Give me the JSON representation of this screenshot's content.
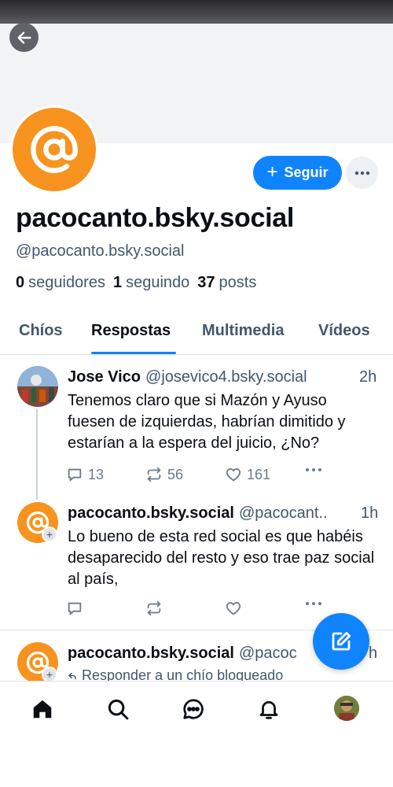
{
  "profile": {
    "display_name": "pacocanto.bsky.social",
    "handle": "@pacocanto.bsky.social",
    "followers_count": "0",
    "followers_label": "seguidores",
    "following_count": "1",
    "following_label": "seguindo",
    "posts_count": "37",
    "posts_label": "posts",
    "follow_label": "Seguir",
    "follow_plus": "+"
  },
  "tabs": [
    {
      "label": "Chíos"
    },
    {
      "label": "Respostas"
    },
    {
      "label": "Multimedia"
    },
    {
      "label": "Vídeos"
    }
  ],
  "active_tab": "Respostas",
  "posts": [
    {
      "author": "Jose Vico",
      "handle": "@josevico4.bsky.social",
      "time": "2h",
      "text": "Tenemos claro que si Mazón y Ayuso fuesen de izquierdas, habrían dimitido y estarían a la espera del juicio, ¿No?",
      "replies": "13",
      "reposts": "56",
      "likes": "161"
    },
    {
      "author": "pacocanto.bsky.social",
      "handle": "@pacocant..",
      "time": "1h",
      "text": "Lo bueno de esta red social es que habéis desaparecido del resto y eso trae paz social al país,",
      "replies": "",
      "reposts": "",
      "likes": ""
    },
    {
      "author": "pacocanto.bsky.social",
      "handle": "@pacoc",
      "time": "h",
      "blocked_reply_label": "Responder a un chío bloqueado"
    }
  ],
  "icons": {
    "back": "back-arrow-icon",
    "at": "at-sign-icon",
    "more": "more-horizontal-icon",
    "compose": "compose-icon",
    "home": "home-icon",
    "search": "search-icon",
    "chat": "chat-icon",
    "notifications": "bell-icon"
  },
  "colors": {
    "accent": "#1083fe",
    "avatar_orange": "#f7931e",
    "muted_text": "#42576c"
  }
}
